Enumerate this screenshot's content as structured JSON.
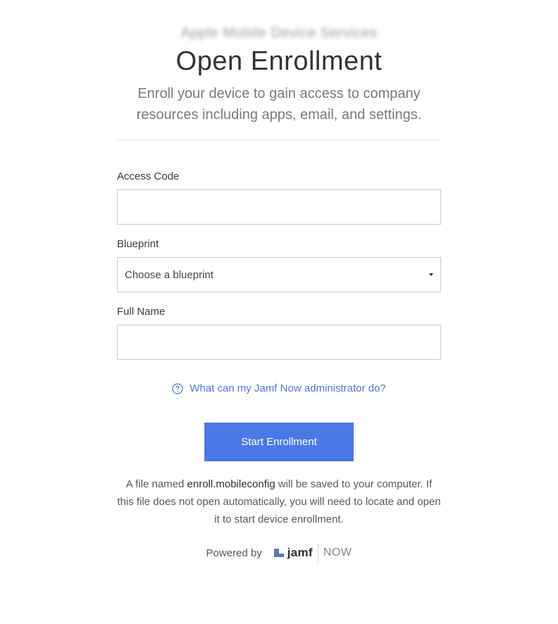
{
  "header": {
    "org_name": "Apple Mobile Device Services",
    "title": "Open Enrollment",
    "subtitle": "Enroll your device to gain access to company resources including apps, email, and settings."
  },
  "form": {
    "access_code": {
      "label": "Access Code",
      "value": "",
      "placeholder": ""
    },
    "blueprint": {
      "label": "Blueprint",
      "selected": "Choose a blueprint"
    },
    "full_name": {
      "label": "Full Name",
      "value": "",
      "placeholder": ""
    }
  },
  "help": {
    "icon": "question-circle-icon",
    "link_text": "What can my Jamf Now administrator do?"
  },
  "actions": {
    "start_label": "Start Enrollment"
  },
  "note": {
    "prefix": "A file named ",
    "filename": "enroll.mobileconfig",
    "suffix": " will be saved to your computer. If this file does not open automatically, you will need to locate and open it to start device enrollment."
  },
  "footer": {
    "powered_by": "Powered by",
    "brand": "jamf",
    "brand_product": "NOW"
  },
  "colors": {
    "accent": "#4a78e6",
    "link": "#4a7ad8",
    "logo_mark": "#5b7bb5"
  }
}
